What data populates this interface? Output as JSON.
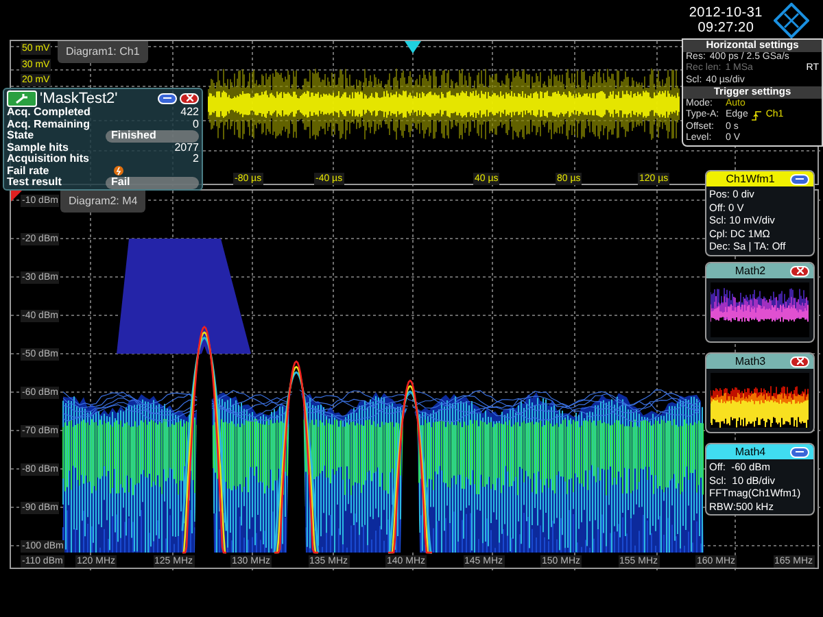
{
  "header": {
    "date": "2012-10-31",
    "time": "09:27:20"
  },
  "diagram1": {
    "tab": "Diagram1: Ch1",
    "y_labels": [
      "50 mV",
      "30 mV",
      "20 mV"
    ],
    "x_labels": [
      "-80 µs",
      "-40 µs",
      "40 µs",
      "80 µs",
      "120 µs"
    ]
  },
  "mask_dialog": {
    "title": "'MaskTest2'",
    "rows": [
      {
        "label": "Acq. Completed",
        "kind": "text",
        "value": "422"
      },
      {
        "label": "Acq. Remaining",
        "kind": "text",
        "value": "0"
      },
      {
        "label": "State",
        "kind": "pill",
        "value": "Finished"
      },
      {
        "label": "Sample hits",
        "kind": "text",
        "value": "2077"
      },
      {
        "label": "Acquisition hits",
        "kind": "text",
        "value": "2"
      },
      {
        "label": "Fail rate",
        "kind": "icon"
      },
      {
        "label": "Test result",
        "kind": "pill",
        "value": "Fail"
      }
    ]
  },
  "horizontal_settings": {
    "title": "Horizontal settings",
    "rows": [
      {
        "label": "Res:",
        "value": "400 ps / 2.5 GSa/s",
        "disabled": false
      },
      {
        "label": "Rec len:",
        "value": "1 MSa",
        "disabled": true,
        "flag": "RT"
      },
      {
        "label": "Scl:",
        "value": "40 µs/div",
        "disabled": false
      }
    ]
  },
  "trigger_settings": {
    "title": "Trigger settings",
    "rows": [
      {
        "label": "Mode:",
        "value": "Auto",
        "highlighted": true
      },
      {
        "label": "Type-A:",
        "value": "Edge",
        "source": "Ch1",
        "highlighted": false
      },
      {
        "label": "Offset:",
        "value": "0 s",
        "highlighted": false
      },
      {
        "label": "Level:",
        "value": "0 V",
        "highlighted": false
      }
    ]
  },
  "diagram2": {
    "tab": "Diagram2: M4",
    "y_labels": [
      "-10 dBm",
      "-20 dBm",
      "-30 dBm",
      "-40 dBm",
      "-50 dBm",
      "-60 dBm",
      "-70 dBm",
      "-80 dBm",
      "-90 dBm",
      "-100 dBm",
      "-110 dBm"
    ],
    "x_labels": [
      "120 MHz",
      "125 MHz",
      "130 MHz",
      "135 MHz",
      "140 MHz",
      "145 MHz",
      "150 MHz",
      "155 MHz",
      "160 MHz",
      "165 MHz"
    ]
  },
  "signal_panels": [
    {
      "title": "Ch1Wfm1",
      "color": "#f0f000",
      "button": {
        "kind": "minimize"
      },
      "kind": "info",
      "lines": [
        "Pos: 0 div",
        "Off: 0 V",
        "Scl: 10 mV/div",
        "Cpl: DC 1MΩ",
        "Dec: Sa | TA: Off"
      ]
    },
    {
      "title": "Math2",
      "color": "#78b4b0",
      "button": {
        "kind": "close"
      },
      "kind": "preview"
    },
    {
      "title": "Math3",
      "color": "#78b4b0",
      "button": {
        "kind": "close"
      },
      "kind": "preview"
    },
    {
      "title": "Math4",
      "color": "#40dcf0",
      "button": {
        "kind": "minimize"
      },
      "kind": "info",
      "lines": [
        "Off:  -60 dBm",
        "Scl:  10 dB/div",
        "FFTmag(Ch1Wfm1)",
        "RBW:500 kHz"
      ]
    }
  ]
}
